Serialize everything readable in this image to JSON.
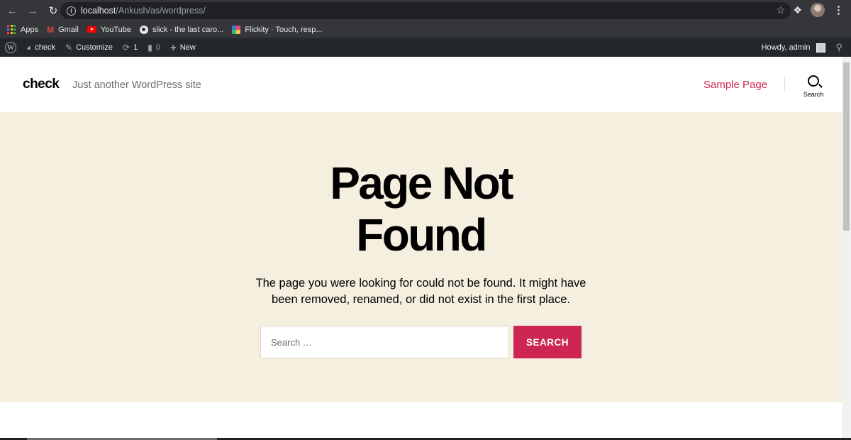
{
  "browser": {
    "url_host": "localhost",
    "url_path": "/Ankush/as/wordpress/",
    "bookmarks": [
      {
        "label": "Apps"
      },
      {
        "label": "Gmail"
      },
      {
        "label": "YouTube"
      },
      {
        "label": "slick - the last caro..."
      },
      {
        "label": "Flickity · Touch, resp..."
      }
    ]
  },
  "adminbar": {
    "site_name": "check",
    "customize": "Customize",
    "updates_count": "1",
    "comments_count": "0",
    "new_label": "New",
    "howdy": "Howdy, admin"
  },
  "header": {
    "site_title": "check",
    "site_description": "Just another WordPress site",
    "menu_item": "Sample Page",
    "search_label": "Search"
  },
  "main": {
    "title_line1": "Page Not",
    "title_line2": "Found",
    "intro": "The page you were looking for could not be found. It might have been removed, renamed, or did not exist in the first place.",
    "search_placeholder": "Search …",
    "search_button": "SEARCH"
  },
  "colors": {
    "accent": "#cd2653",
    "background_band": "#f5efe0",
    "adminbar": "#23282d"
  }
}
